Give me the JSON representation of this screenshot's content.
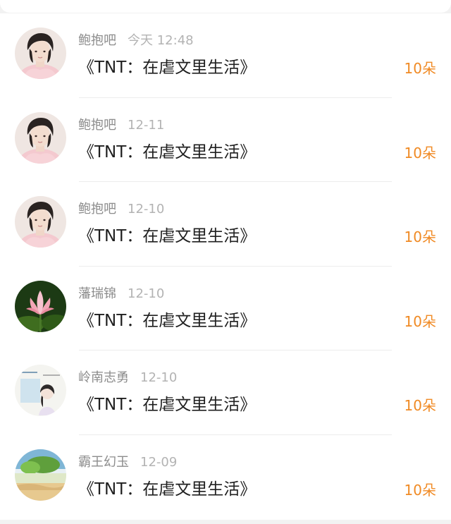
{
  "records": [
    {
      "user": "鲍抱吧",
      "time": "今天 12:48",
      "title": "《TNT：在虐文里生活》",
      "amount": "10朵",
      "avatar": "girl-portrait"
    },
    {
      "user": "鲍抱吧",
      "time": "12-11",
      "title": "《TNT：在虐文里生活》",
      "amount": "10朵",
      "avatar": "girl-portrait"
    },
    {
      "user": "鲍抱吧",
      "time": "12-10",
      "title": "《TNT：在虐文里生活》",
      "amount": "10朵",
      "avatar": "girl-portrait"
    },
    {
      "user": "藩瑞锦",
      "time": "12-10",
      "title": "《TNT：在虐文里生活》",
      "amount": "10朵",
      "avatar": "lotus-flower"
    },
    {
      "user": "岭南志勇",
      "time": "12-10",
      "title": "《TNT：在虐文里生活》",
      "amount": "10朵",
      "avatar": "anime-girl-poster"
    },
    {
      "user": "霸王幻玉",
      "time": "12-09",
      "title": "《TNT：在虐文里生活》",
      "amount": "10朵",
      "avatar": "landscape-painting"
    }
  ],
  "colors": {
    "amount": "#f08a24",
    "username": "#8c8c8c",
    "timestamp": "#b3b3b3",
    "title": "#1f1f1f",
    "divider": "#ececec"
  }
}
